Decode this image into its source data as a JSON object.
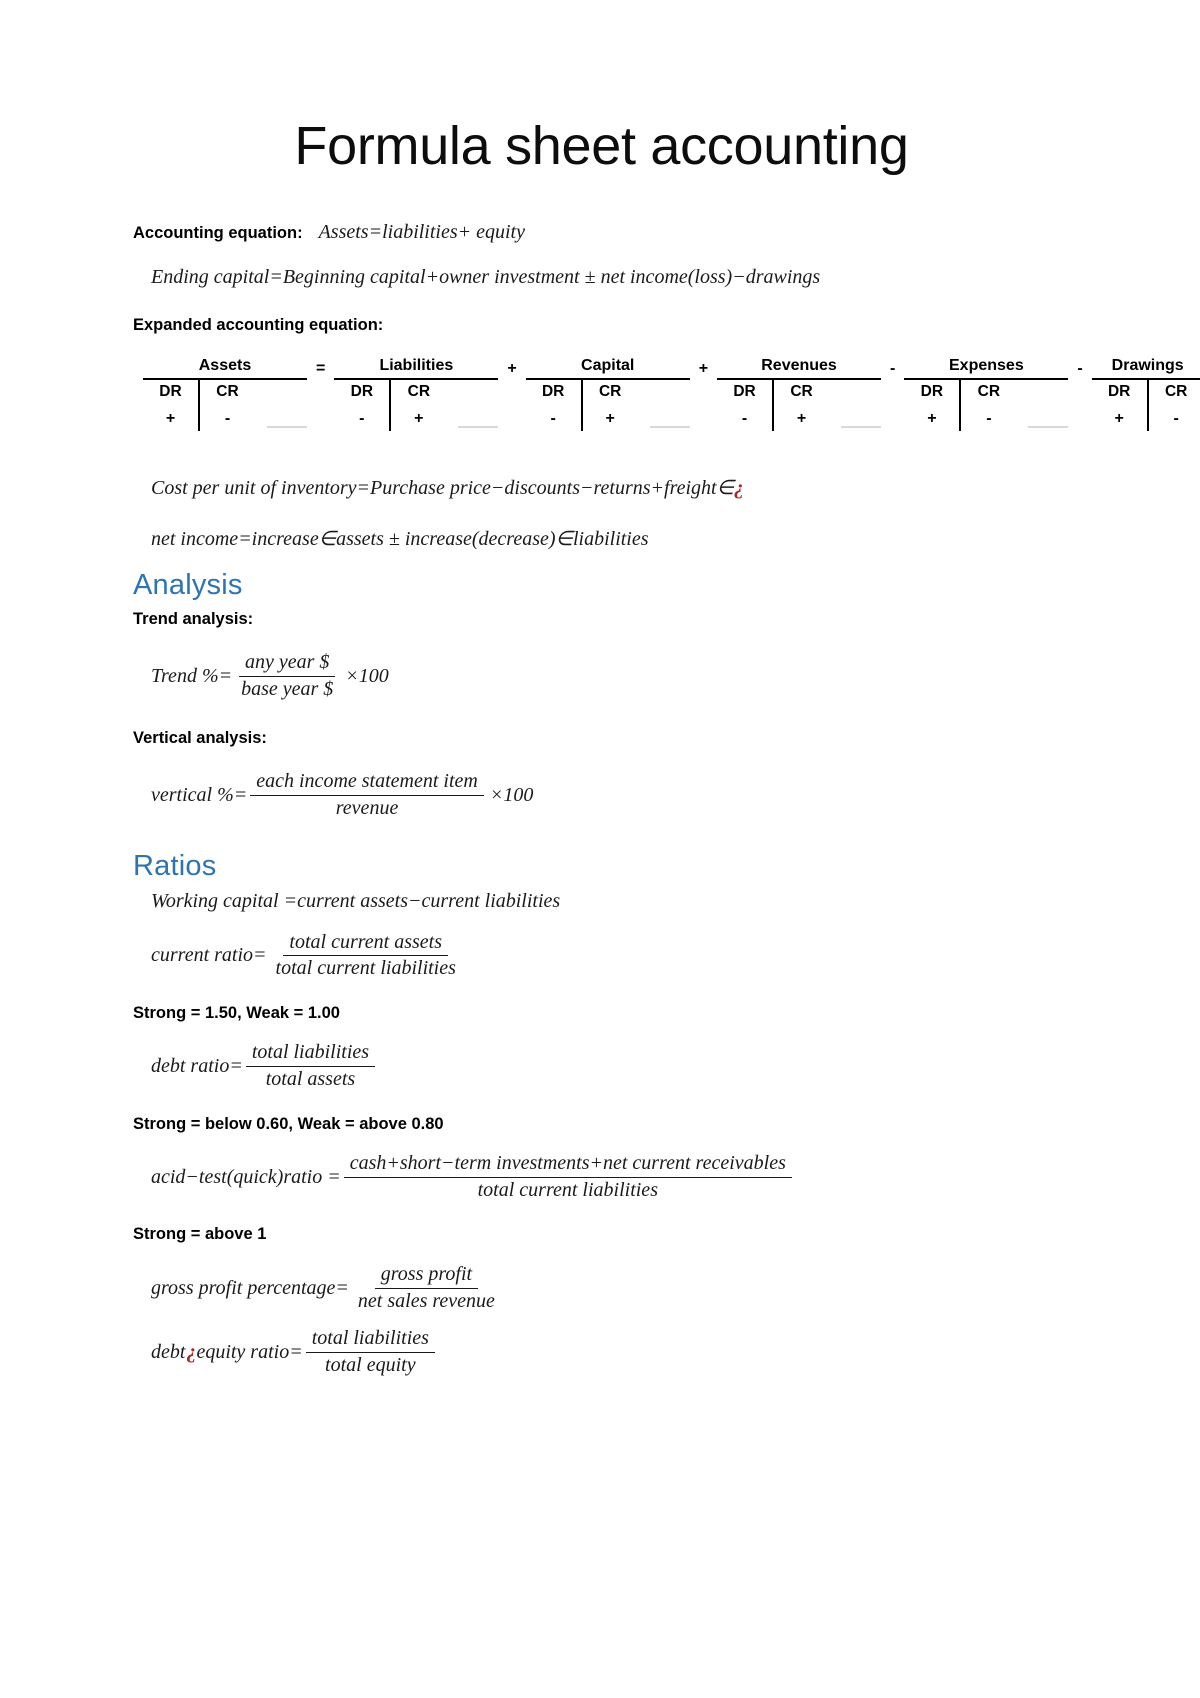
{
  "document": {
    "title": "Formula sheet accounting",
    "accent_color": "#2E74B5",
    "red_color": "#B22222"
  },
  "intro": {
    "accounting_equation_label": "Accounting equation:",
    "accounting_equation": "Assets=liabilities+ equity",
    "ending_capital": "Ending capital=Beginning capital+owner investment ± net income(loss)−drawings",
    "expanded_label": "Expanded accounting equation:"
  },
  "expanded_table": {
    "groups": [
      {
        "name": "Assets",
        "operator_before": "",
        "dr_label": "DR",
        "cr_label": "CR",
        "dr_sign": "+",
        "cr_sign": "-"
      },
      {
        "name": "Liabilities",
        "operator_before": "=",
        "dr_label": "DR",
        "cr_label": "CR",
        "dr_sign": "-",
        "cr_sign": "+"
      },
      {
        "name": "Capital",
        "operator_before": "+",
        "dr_label": "DR",
        "cr_label": "CR",
        "dr_sign": "-",
        "cr_sign": "+"
      },
      {
        "name": "Revenues",
        "operator_before": "+",
        "dr_label": "DR",
        "cr_label": "CR",
        "dr_sign": "-",
        "cr_sign": "+"
      },
      {
        "name": "Expenses",
        "operator_before": "-",
        "dr_label": "DR",
        "cr_label": "CR",
        "dr_sign": "+",
        "cr_sign": "-"
      },
      {
        "name": "Drawings",
        "operator_before": "-",
        "dr_label": "DR",
        "cr_label": "CR",
        "dr_sign": "+",
        "cr_sign": "-"
      }
    ]
  },
  "inventory": {
    "cost_per_unit_main": "Cost per unit of inventory=Purchase price−discounts−returns+freight∈",
    "cost_per_unit_red": "¿",
    "net_income": "net income=increase∈assets ± increase(decrease)∈liabilities"
  },
  "analysis": {
    "heading": "Analysis",
    "trend_label": "Trend analysis:",
    "trend": {
      "lhs": "Trend %=",
      "numerator": "any year $",
      "denominator": "base year $",
      "tail": "×100"
    },
    "vertical_label": "Vertical analysis:",
    "vertical": {
      "lhs": "vertical %=",
      "numerator": "each income statement item",
      "denominator": "revenue",
      "tail": "×100"
    }
  },
  "ratios": {
    "heading": "Ratios",
    "working_capital": "Working capital =current assets−current liabilities",
    "current_ratio": {
      "lhs": "current ratio=",
      "numerator": "total current assets",
      "denominator": "total current liabilities"
    },
    "current_ratio_note": "Strong = 1.50, Weak = 1.00",
    "debt_ratio": {
      "lhs": "debt ratio=",
      "numerator": "total liabilities",
      "denominator": "total assets"
    },
    "debt_ratio_note": "Strong = below 0.60, Weak = above 0.80",
    "acid_test": {
      "lhs": "acid−test(quick)ratio =",
      "numerator": "cash+short−term investments+net current receivables",
      "denominator": "total current liabilities"
    },
    "acid_test_note": "Strong = above 1",
    "gross_profit": {
      "lhs": "gross profit percentage=",
      "numerator": "gross profit",
      "denominator": "net sales revenue"
    },
    "debt_to_equity": {
      "lhs_a": "debt ",
      "lhs_red": "¿",
      "lhs_b": " equity ratio=",
      "numerator": "total liabilities",
      "denominator": "total equity"
    }
  }
}
